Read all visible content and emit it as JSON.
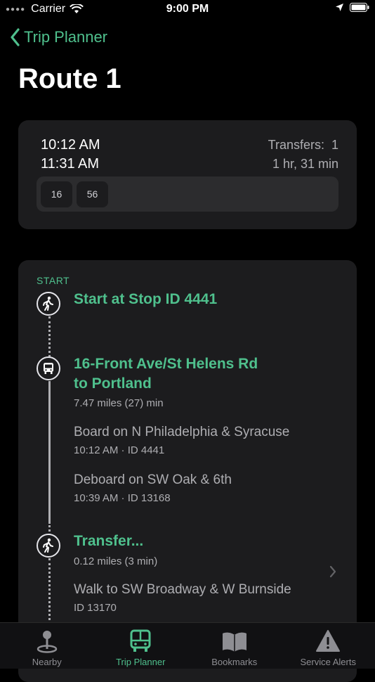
{
  "status": {
    "carrier": "Carrier",
    "time": "9:00 PM"
  },
  "nav": {
    "back_label": "Trip Planner"
  },
  "page_title": "Route 1",
  "summary": {
    "depart_time": "10:12 AM",
    "arrive_time": "11:31 AM",
    "transfers": "Transfers:  1",
    "duration": "1 hr, 31 min",
    "routes": [
      "16",
      "56"
    ]
  },
  "itinerary": {
    "start_label": "START",
    "steps": [
      {
        "icon": "walk-icon",
        "title": "Start at Stop ID 4441"
      },
      {
        "icon": "bus-icon",
        "title_line1": "16-Front Ave/St Helens Rd",
        "title_line2": "to Portland",
        "subtitle": "7.47 miles (27) min",
        "board": "Board on N Philadelphia & Syracuse",
        "board_meta": "10:12 AM · ID 4441",
        "deboard": "Deboard on SW Oak & 6th",
        "deboard_meta": "10:39 AM · ID 13168"
      },
      {
        "icon": "walk-icon",
        "title": "Transfer...",
        "subtitle": "0.12 miles (3 min)",
        "walk": "Walk to SW Broadway & W Burnside",
        "walk_meta": "ID 13170"
      }
    ]
  },
  "tabs": [
    {
      "label": "Nearby",
      "icon": "map-pin-icon",
      "active": false
    },
    {
      "label": "Trip Planner",
      "icon": "bus-icon",
      "active": true
    },
    {
      "label": "Bookmarks",
      "icon": "book-icon",
      "active": false
    },
    {
      "label": "Service Alerts",
      "icon": "warning-icon",
      "active": false
    }
  ],
  "colors": {
    "accent": "#4fc08d",
    "card": "#1c1c1e",
    "background": "#000000"
  }
}
